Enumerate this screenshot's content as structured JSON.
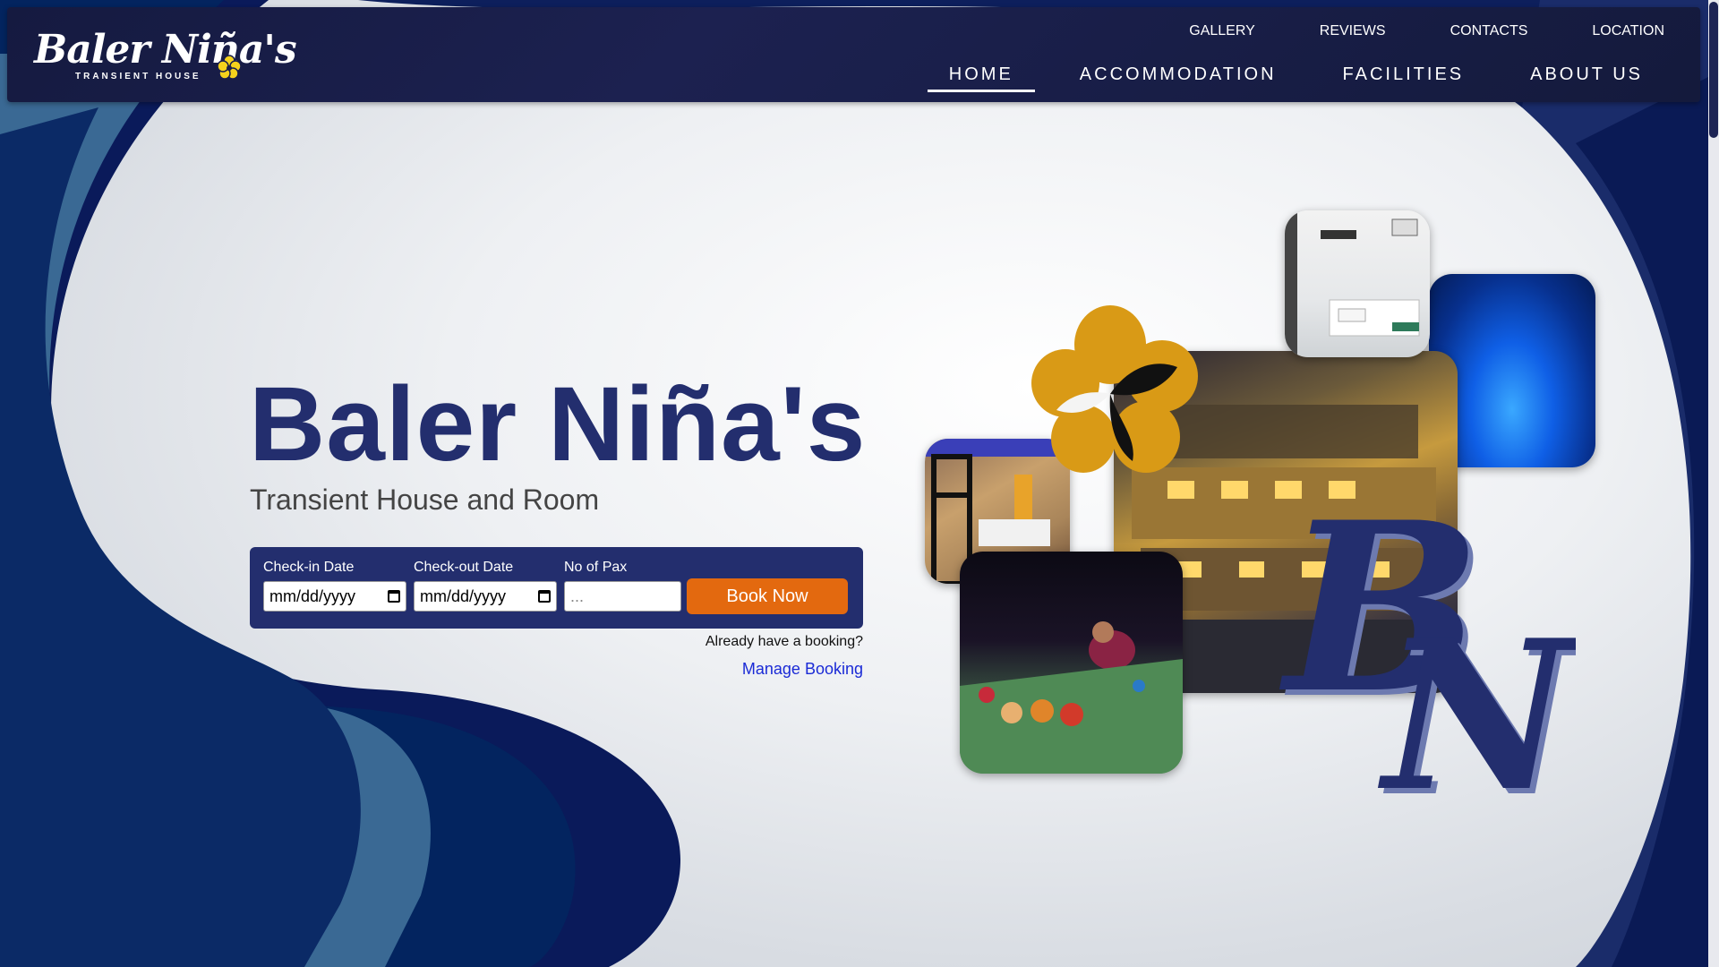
{
  "brand": {
    "logo_main": "Baler Niña's",
    "logo_sub": "TRANSIENT HOUSE"
  },
  "nav": {
    "top_links": [
      "GALLERY",
      "REVIEWS",
      "CONTACTS",
      "LOCATION"
    ],
    "main_links": [
      "HOME",
      "ACCOMMODATION",
      "FACILITIES",
      "ABOUT US"
    ],
    "active": "HOME"
  },
  "hero": {
    "title": "Baler Niña's",
    "subtitle": "Transient House and Room"
  },
  "booking": {
    "checkin_label": "Check-in Date",
    "checkin_value": "mm/dd/yyyy",
    "checkout_label": "Check-out Date",
    "checkout_value": "mm/dd/yyyy",
    "pax_label": "No of Pax",
    "pax_placeholder": "...",
    "book_button": "Book Now",
    "already_text": "Already have a booking?",
    "manage_link": "Manage Booking"
  },
  "colors": {
    "navy": "#232e6e",
    "header": "#1a1f4a",
    "accent_orange": "#e3690f",
    "flower_gold": "#d99a16",
    "link_blue": "#1a2ad6"
  },
  "icons": [
    "hibiscus-flower-icon",
    "calendar-icon",
    "bn-monogram"
  ]
}
